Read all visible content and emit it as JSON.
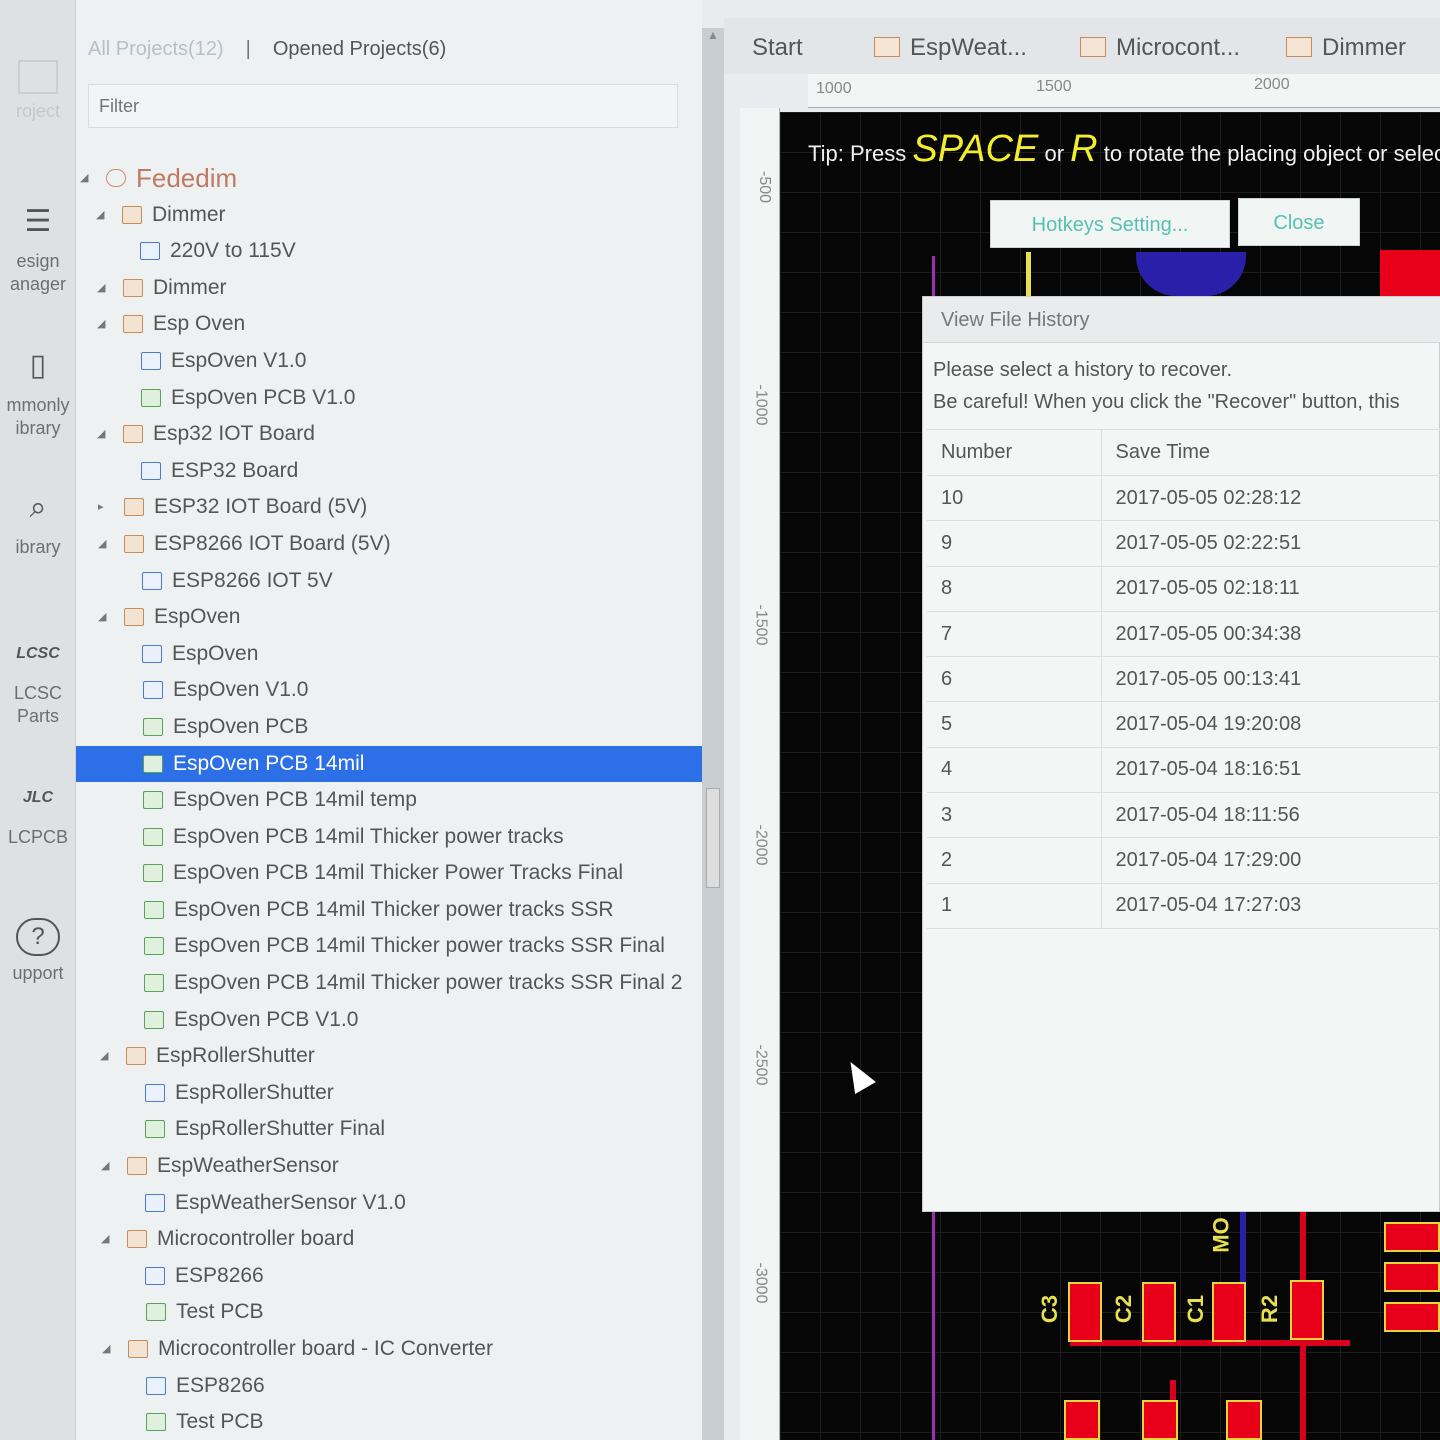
{
  "rail": {
    "items": [
      {
        "label": "roject",
        "icon": "project-icon"
      },
      {
        "label": "esign anager",
        "icon": "design-manager-icon"
      },
      {
        "label": "mmonly ibrary",
        "icon": "commonly-library-icon"
      },
      {
        "label": "ibrary",
        "icon": "library-search-icon"
      },
      {
        "label": "LCSC Parts",
        "icon": "lcsc-logo-icon"
      },
      {
        "label": "LCPCB",
        "icon": "jlc-logo-icon"
      },
      {
        "label": "upport",
        "icon": "support-icon"
      }
    ]
  },
  "panel": {
    "tab_all": "All Projects(12)",
    "tab_sep": "|",
    "tab_opened": "Opened Projects(6)",
    "filter_placeholder": "Filter",
    "tree": [
      {
        "label": "Fededim",
        "type": "user",
        "level": 0,
        "arrow": "◢"
      },
      {
        "label": "Dimmer",
        "type": "folder",
        "level": 1,
        "arrow": "◢"
      },
      {
        "label": "220V to 115V",
        "type": "sch",
        "level": 2
      },
      {
        "label": "Dimmer",
        "type": "folder",
        "level": 1,
        "arrow": "◢"
      },
      {
        "label": "Esp Oven",
        "type": "folder",
        "level": 1,
        "arrow": "◢"
      },
      {
        "label": "EspOven V1.0",
        "type": "sch",
        "level": 2
      },
      {
        "label": "EspOven PCB V1.0",
        "type": "pcb",
        "level": 2
      },
      {
        "label": "Esp32 IOT Board",
        "type": "folder",
        "level": 1,
        "arrow": "◢"
      },
      {
        "label": "ESP32 Board",
        "type": "sch",
        "level": 2
      },
      {
        "label": "ESP32 IOT Board (5V)",
        "type": "folder",
        "level": 1,
        "arrow": "▸"
      },
      {
        "label": "ESP8266 IOT Board (5V)",
        "type": "folder",
        "level": 1,
        "arrow": "◢"
      },
      {
        "label": "ESP8266 IOT 5V",
        "type": "sch",
        "level": 2
      },
      {
        "label": "EspOven",
        "type": "folder",
        "level": 1,
        "arrow": "◢"
      },
      {
        "label": "EspOven",
        "type": "sch",
        "level": 2
      },
      {
        "label": "EspOven V1.0",
        "type": "sch",
        "level": 2
      },
      {
        "label": "EspOven PCB",
        "type": "pcb",
        "level": 2
      },
      {
        "label": "EspOven PCB 14mil",
        "type": "pcb",
        "level": 2,
        "selected": true
      },
      {
        "label": "EspOven PCB 14mil temp",
        "type": "pcb",
        "level": 2
      },
      {
        "label": "EspOven PCB 14mil Thicker power tracks",
        "type": "pcb",
        "level": 2
      },
      {
        "label": "EspOven PCB 14mil Thicker Power Tracks Final",
        "type": "pcb",
        "level": 2
      },
      {
        "label": "EspOven PCB 14mil Thicker power tracks SSR",
        "type": "pcb",
        "level": 2
      },
      {
        "label": "EspOven PCB 14mil Thicker power tracks SSR Final",
        "type": "pcb",
        "level": 2
      },
      {
        "label": "EspOven PCB 14mil Thicker power tracks SSR Final 2",
        "type": "pcb",
        "level": 2
      },
      {
        "label": "EspOven PCB V1.0",
        "type": "pcb",
        "level": 2
      },
      {
        "label": "EspRollerShutter",
        "type": "folder",
        "level": 1,
        "arrow": "◢"
      },
      {
        "label": "EspRollerShutter",
        "type": "sch",
        "level": 2
      },
      {
        "label": "EspRollerShutter Final",
        "type": "pcb",
        "level": 2
      },
      {
        "label": "EspWeatherSensor",
        "type": "folder",
        "level": 1,
        "arrow": "◢"
      },
      {
        "label": "EspWeatherSensor V1.0",
        "type": "sch",
        "level": 2
      },
      {
        "label": "Microcontroller board",
        "type": "folder",
        "level": 1,
        "arrow": "◢"
      },
      {
        "label": "ESP8266",
        "type": "sch",
        "level": 2
      },
      {
        "label": "Test PCB",
        "type": "pcb",
        "level": 2
      },
      {
        "label": "Microcontroller board - IC Converter",
        "type": "folder",
        "level": 1,
        "arrow": "◢"
      },
      {
        "label": "ESP8266",
        "type": "sch",
        "level": 2
      },
      {
        "label": "Test PCB",
        "type": "pcb",
        "level": 2
      }
    ]
  },
  "tabs": [
    {
      "label": "Start",
      "icon": false
    },
    {
      "label": "EspWeat...",
      "icon": true
    },
    {
      "label": "Microcont...",
      "icon": true
    },
    {
      "label": "Dimmer",
      "icon": true
    }
  ],
  "rulers": {
    "h": [
      "1000",
      "1500",
      "2000"
    ],
    "v": [
      "-500",
      "-1000",
      "-1500",
      "-2000",
      "-2500",
      "-3000"
    ]
  },
  "tip": {
    "prefix": "Tip: Press",
    "key1": "SPACE",
    "mid": "or",
    "key2": "R",
    "suffix": "to rotate the placing object or selec"
  },
  "buttons": {
    "hotkeys": "Hotkeys Setting...",
    "close": "Close"
  },
  "dialog": {
    "title": "View File History",
    "msg1": "Please select a history to recover.",
    "msg2": "Be careful! When you click the \"Recover\" button, this",
    "col_number": "Number",
    "col_time": "Save Time",
    "rows": [
      {
        "number": "10",
        "time": "2017-05-05 02:28:12"
      },
      {
        "number": "9",
        "time": "2017-05-05 02:22:51"
      },
      {
        "number": "8",
        "time": "2017-05-05 02:18:11"
      },
      {
        "number": "7",
        "time": "2017-05-05 00:34:38"
      },
      {
        "number": "6",
        "time": "2017-05-05 00:13:41"
      },
      {
        "number": "5",
        "time": "2017-05-04 19:20:08"
      },
      {
        "number": "4",
        "time": "2017-05-04 18:16:51"
      },
      {
        "number": "3",
        "time": "2017-05-04 18:11:56"
      },
      {
        "number": "2",
        "time": "2017-05-04 17:29:00"
      },
      {
        "number": "1",
        "time": "2017-05-04 17:27:03"
      }
    ]
  },
  "pcb": {
    "labels": [
      "C3",
      "C2",
      "C1",
      "R2",
      "MO"
    ]
  },
  "colors": {
    "selection": "#2d6fe6",
    "tip_key": "#f2ee2e",
    "button_text": "#57c0b1",
    "pad": "#e8001a",
    "silk": "#e8e050"
  }
}
